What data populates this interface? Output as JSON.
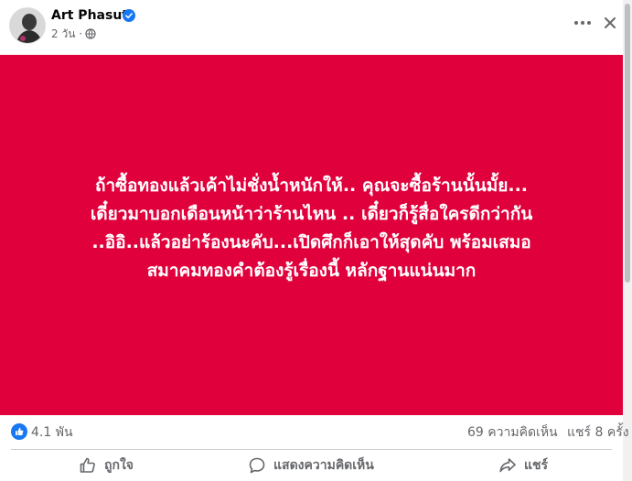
{
  "post": {
    "author": "Art Phasut",
    "time": "2 วัน ·",
    "text_lines": [
      "ถ้าซื้อทองแล้วเค้าไม่ชั่งน้ำหนักให้.. คุณจะซื้อร้านนั้นมั้ย...",
      "เดี๋ยวมาบอกเดือนหน้าว่าร้านไหน .. เดี๋ยวก็รู้สื่อใครดีกว่ากัน",
      "..อิอิ..แล้วอย่าร้องนะคับ...เปิดศึกก็เอาให้สุดคับ พร้อมเสมอ",
      "สมาคมทองคำต้องรู้เรื่องนี้ หลักฐานแน่นมาก"
    ],
    "background_color": "#e0003c"
  },
  "stats": {
    "reactions": "4.1 พัน",
    "comments": "69 ความคิดเห็น",
    "shares": "แชร์ 8 ครั้ง"
  },
  "actions": {
    "like": "ถูกใจ",
    "comment": "แสดงความคิดเห็น",
    "share": "แชร์"
  },
  "icons": {
    "verified": "verified-badge-icon",
    "privacy": "globe-icon",
    "more": "more-options-icon",
    "close": "close-icon",
    "reaction": "like-reaction-icon"
  },
  "colors": {
    "accent": "#1877f2",
    "muted_text": "#65676b"
  }
}
